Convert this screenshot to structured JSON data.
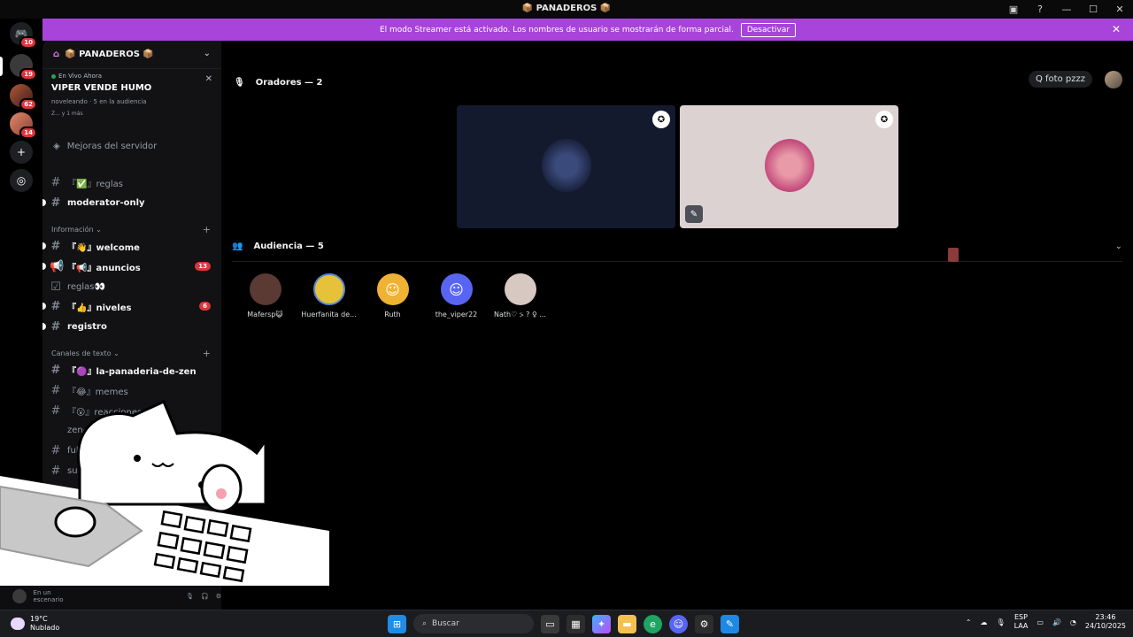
{
  "window": {
    "title": "📦 PANADEROS 📦"
  },
  "banner": {
    "text": "El modo Streamer está activado. Los nombres de usuario se mostrarán de forma parcial.",
    "button": "Desactivar"
  },
  "servers": [
    {
      "badge": "10"
    },
    {
      "badge": "19"
    },
    {
      "badge": "62"
    },
    {
      "badge": "14"
    }
  ],
  "server_header": {
    "name": "📦 PANADEROS 📦"
  },
  "live": {
    "tag": "En Vivo Ahora",
    "title": "VIPER VENDE HUMO",
    "meta": "noveleando · 5 en la audiencia",
    "meta2": "Z... y 1 más"
  },
  "boost": {
    "label": "Mejoras del servidor"
  },
  "channels": {
    "reglas_top": "『✅』reglas",
    "moderator": "moderator-only",
    "cat_info": "Información ⌄",
    "welcome": "『👋』welcome",
    "anuncios": "『📢』anuncios",
    "anuncios_badge": "13",
    "reglas": "reglas👀",
    "niveles": "『👍』niveles",
    "niveles_badge": "6",
    "registro": "registro",
    "cat_text": "Canales de texto ⌄",
    "panaderia": "『🟣』la-panaderia-de-zen",
    "memes": "『😂』memes",
    "reacciones": "『😮』reacciones",
    "zen_priv": "zen-priv",
    "full": "full-t",
    "su": "su"
  },
  "userpanel": {
    "status": "En un escenario"
  },
  "stage": {
    "speakers_header": "Oradores — 2",
    "search_pill": "Q foto pzzz",
    "audience_header": "Audiencia — 5",
    "audience": [
      {
        "name": "Mafersp😺",
        "color": "#5a3a33"
      },
      {
        "name": "Huerfanita de...",
        "color": "#e6c23a"
      },
      {
        "name": "Ruth",
        "color": "#f0b232"
      },
      {
        "name": "the_viper22",
        "color": "#5865f2"
      },
      {
        "name": "Nath♡ ⍩ ? ♀ ...",
        "color": "#d8c8c2"
      }
    ]
  },
  "taskbar": {
    "weather_temp": "19°C",
    "weather_desc": "Nublado",
    "search": "Buscar",
    "lang1": "ESP",
    "lang2": "LAA",
    "time": "23:46",
    "date": "24/10/2025"
  },
  "colors": {
    "accent": "#a844d9",
    "discord": "#5865f2",
    "danger": "#da373c",
    "online": "#23a55a"
  }
}
